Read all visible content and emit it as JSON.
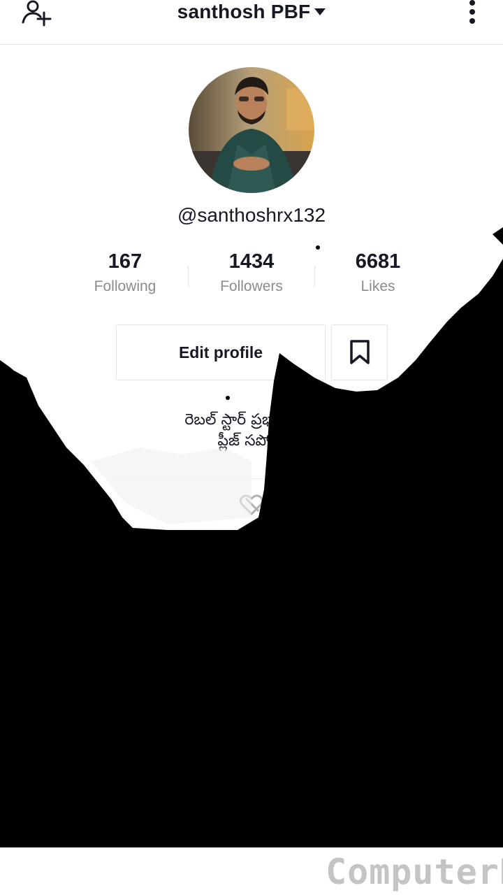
{
  "header": {
    "title": "santhosh PBF",
    "add_user_icon": "add-user-icon",
    "menu_icon": "more-vertical-icon"
  },
  "profile": {
    "handle": "@santhoshrx132",
    "avatar_icon": "profile-photo"
  },
  "stats": [
    {
      "value": "167",
      "label": "Following"
    },
    {
      "value": "1434",
      "label": "Followers"
    },
    {
      "value": "6681",
      "label": "Likes"
    }
  ],
  "actions": {
    "edit_profile": "Edit profile",
    "bookmark_icon": "bookmark-icon"
  },
  "bio": {
    "line1": "రెబల్ స్టార్ ప్రభాస్ డార్లి",
    "line2": "ప్లీజ్ సపోర్టు"
  },
  "tabs": {
    "liked_icon": "heart-icon"
  },
  "overlay": {
    "color": "#000000"
  },
  "watermark": "ComputerH"
}
